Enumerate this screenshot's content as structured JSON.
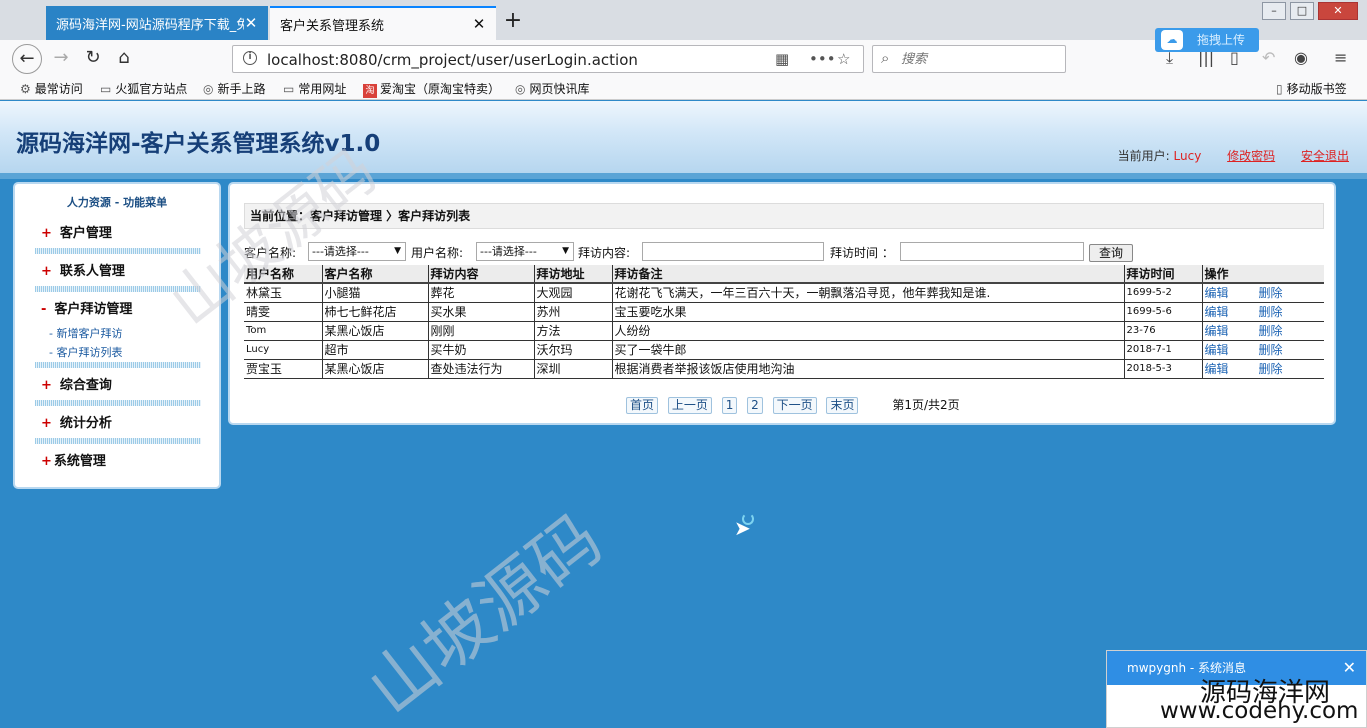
{
  "browser": {
    "tabs": [
      {
        "title": "源码海洋网-网站源码程序下载_免费",
        "close": "✕"
      },
      {
        "title": "客户关系管理系统",
        "close": "✕"
      }
    ],
    "new_tab": "+",
    "url": "localhost:8080/crm_project/user/userLogin.action",
    "search_placeholder": "搜索",
    "upload_label": "拖拽上传",
    "bookmarks": [
      "最常访问",
      "火狐官方站点",
      "新手上路",
      "常用网址",
      "爱淘宝（原淘宝特卖）",
      "网页快讯库"
    ],
    "bookmarks_right": "移动版书签"
  },
  "header": {
    "title": "源码海洋网-客户关系管理系统v1.0",
    "current_user_label": "当前用户:",
    "current_user": "Lucy",
    "change_password": "修改密码",
    "logout": "安全退出"
  },
  "sidebar": {
    "heading": "人力资源  - 功能菜单",
    "menus": [
      "客户管理",
      "联系人管理",
      "客户拜访管理",
      "综合查询",
      "统计分析",
      "系统管理"
    ],
    "submenus": [
      "- 新增客户拜访",
      "- 客户拜访列表"
    ],
    "marker_collapsed": "+",
    "marker_expanded": "-"
  },
  "main": {
    "breadcrumb": "当前位置：客户拜访管理 〉客户拜访列表",
    "filters": {
      "customer_label": "客户名称:",
      "customer_select": "---请选择---",
      "user_label": "用户名称:",
      "user_select": "---请选择---",
      "content_label": "拜访内容:",
      "time_label": "拜访时间 ：",
      "query_button": "查询"
    },
    "columns": [
      "用户名称",
      "客户名称",
      "拜访内容",
      "拜访地址",
      "拜访备注",
      "拜访时间",
      "操作"
    ],
    "rows": [
      {
        "user": "林黛玉",
        "customer": "小腿猫",
        "content": "葬花",
        "address": "大观园",
        "note": "花谢花飞飞满天，一年三百六十天，一朝飘落沿寻觅，他年葬我知是谁.",
        "time": "1699-5-2",
        "edit": "编辑",
        "delete": "删除"
      },
      {
        "user": "晴雯",
        "customer": "柿七七鲜花店",
        "content": "买水果",
        "address": "苏州",
        "note": "宝玉要吃水果",
        "time": "1699-5-6",
        "edit": "编辑",
        "delete": "删除"
      },
      {
        "user": "Tom",
        "customer": "某黑心饭店",
        "content": "刚刚",
        "address": "方法",
        "note": "人纷纷",
        "time": "23-76",
        "edit": "编辑",
        "delete": "删除"
      },
      {
        "user": "Lucy",
        "customer": "超市",
        "content": "买牛奶",
        "address": "沃尔玛",
        "note": "买了一袋牛郎",
        "time": "2018-7-1",
        "edit": "编辑",
        "delete": "删除"
      },
      {
        "user": "贾宝玉",
        "customer": "某黑心饭店",
        "content": "查处违法行为",
        "address": "深圳",
        "note": "根据消费者举报该饭店使用地沟油",
        "time": "2018-5-3",
        "edit": "编辑",
        "delete": "删除"
      }
    ],
    "pager": {
      "first": "首页",
      "prev": "上一页",
      "p1": "1",
      "p2": "2",
      "next": "下一页",
      "last": "末页",
      "info": "第1页/共2页"
    }
  },
  "watermark": "山坡源码",
  "notification": {
    "title": "mwpygnh - 系统消息",
    "close": "✕"
  },
  "brand": {
    "line1": "源码海洋网",
    "line2": "www.codehy.com"
  }
}
